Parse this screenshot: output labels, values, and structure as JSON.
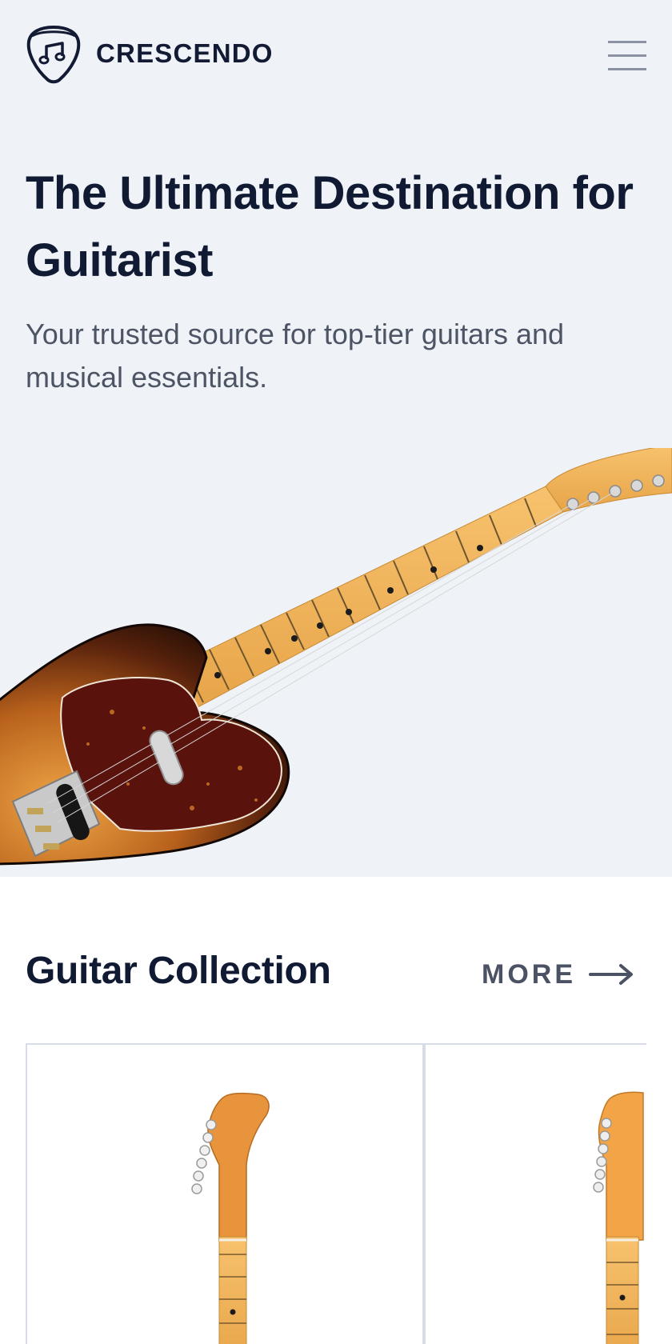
{
  "header": {
    "brand": "CRESCENDO",
    "logo_icon": "guitar-pick-music-note-icon",
    "menu_icon": "hamburger-menu-icon"
  },
  "hero": {
    "title": "The Ultimate Destination for Guitarist",
    "subtitle": "Your trusted source for top-tier guitars and musical essentials.",
    "image": "sunburst-telecaster-guitar"
  },
  "collection": {
    "title": "Guitar Collection",
    "more_label": "MORE",
    "more_icon": "arrow-right-icon",
    "products": [
      {
        "image": "stratocaster-headstock-vintage"
      },
      {
        "image": "stratocaster-headstock-natural"
      }
    ]
  },
  "colors": {
    "hero_background": "#eff3f8",
    "text_dark": "#111a33",
    "text_muted": "#4d5565",
    "card_border": "#d7dce5"
  }
}
